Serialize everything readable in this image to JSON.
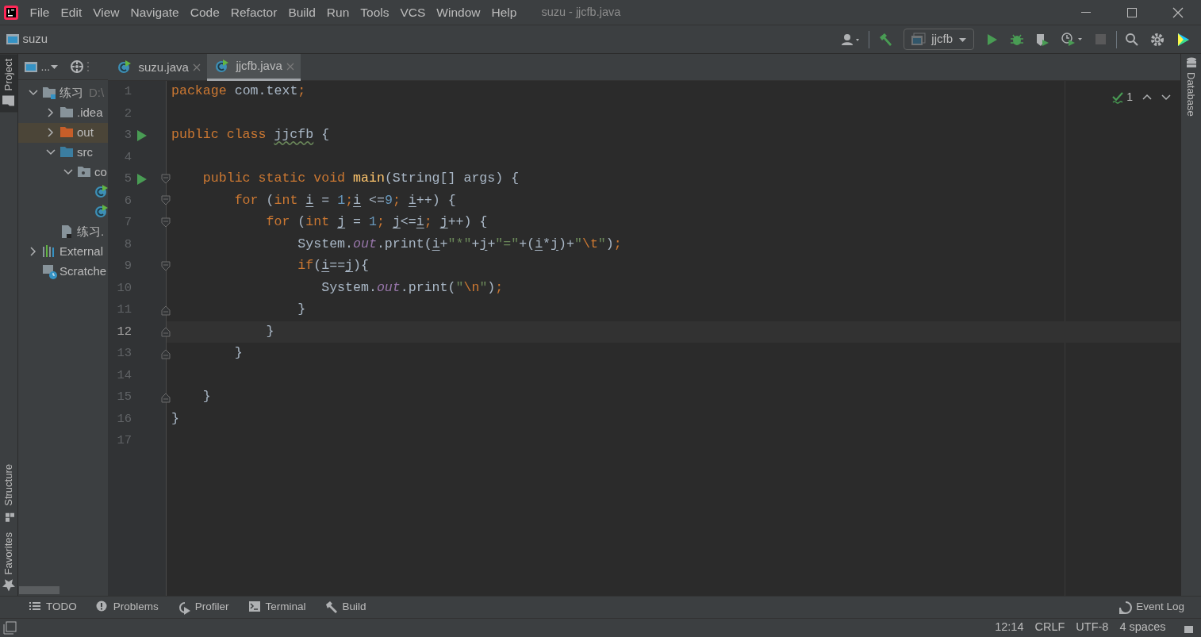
{
  "window": {
    "title": "suzu - jjcfb.java"
  },
  "menu": [
    "File",
    "Edit",
    "View",
    "Navigate",
    "Code",
    "Refactor",
    "Build",
    "Run",
    "Tools",
    "VCS",
    "Window",
    "Help"
  ],
  "navigation": {
    "project": "suzu",
    "run_configuration": "jjcfb"
  },
  "left_stripe": [
    {
      "label": "Project",
      "selected": true
    },
    {
      "label": "Structure",
      "selected": false
    },
    {
      "label": "Favorites",
      "selected": false
    }
  ],
  "right_stripe": [
    {
      "label": "Database",
      "selected": false
    }
  ],
  "project_panel": {
    "view_selector": "..."
  },
  "project_tree": [
    {
      "label": "练习",
      "path": "D:\\",
      "kind": "module",
      "expanded": true,
      "selected": false,
      "children": [
        {
          "label": ".idea",
          "kind": "folder",
          "expanded": false,
          "selected": false
        },
        {
          "label": "out",
          "kind": "excluded",
          "expanded": false,
          "selected": true
        },
        {
          "label": "src",
          "kind": "source",
          "expanded": true,
          "selected": false,
          "children": [
            {
              "label": "co",
              "kind": "package",
              "expanded": true,
              "selected": false,
              "children": [
                {
                  "kind": "class",
                  "selected": false
                },
                {
                  "kind": "class",
                  "selected": false
                }
              ]
            }
          ]
        },
        {
          "label": "练习.",
          "kind": "iml",
          "selected": false
        }
      ]
    },
    {
      "label": "External",
      "kind": "libraries",
      "expanded": false,
      "selected": false
    },
    {
      "label": "Scratche",
      "kind": "scratches",
      "selected": false
    }
  ],
  "editor_tabs": [
    {
      "label": "suzu.java",
      "selected": false
    },
    {
      "label": "jjcfb.java",
      "selected": true
    }
  ],
  "inspection": {
    "count": "1"
  },
  "code_lines": [
    {
      "number": "1",
      "tokens": [
        {
          "text": "package",
          "kind": "keyword"
        },
        {
          "text": " com.text",
          "kind": "plain"
        },
        {
          "text": ";",
          "kind": "keyword"
        }
      ]
    },
    {
      "number": "2"
    },
    {
      "number": "3",
      "run": true,
      "tokens": [
        {
          "text": "public class ",
          "kind": "keyword"
        },
        {
          "text": "jjcfb",
          "kind": "typo"
        },
        {
          "text": " {",
          "kind": "plain"
        }
      ]
    },
    {
      "number": "4"
    },
    {
      "number": "5",
      "run": true,
      "fold_start": true,
      "tokens": [
        {
          "text": "    public static void ",
          "kind": "keyword"
        },
        {
          "text": "main",
          "kind": "method"
        },
        {
          "text": "(String[] args) {",
          "kind": "plain"
        }
      ]
    },
    {
      "number": "6",
      "fold_start": true,
      "tokens": [
        {
          "text": "        for",
          "kind": "keyword"
        },
        {
          "text": " (",
          "kind": "plain"
        },
        {
          "text": "int ",
          "kind": "keyword"
        },
        {
          "text": "i",
          "kind": "var"
        },
        {
          "text": " = ",
          "kind": "plain"
        },
        {
          "text": "1",
          "kind": "number"
        },
        {
          "text": ";",
          "kind": "keyword"
        },
        {
          "text": "i",
          "kind": "var"
        },
        {
          "text": " <=",
          "kind": "plain"
        },
        {
          "text": "9",
          "kind": "number"
        },
        {
          "text": "; ",
          "kind": "keyword"
        },
        {
          "text": "i",
          "kind": "var"
        },
        {
          "text": "++) {",
          "kind": "plain"
        }
      ]
    },
    {
      "number": "7",
      "fold_start": true,
      "tokens": [
        {
          "text": "            for",
          "kind": "keyword"
        },
        {
          "text": " (",
          "kind": "plain"
        },
        {
          "text": "int ",
          "kind": "keyword"
        },
        {
          "text": "j",
          "kind": "var"
        },
        {
          "text": " = ",
          "kind": "plain"
        },
        {
          "text": "1",
          "kind": "number"
        },
        {
          "text": "; ",
          "kind": "keyword"
        },
        {
          "text": "j",
          "kind": "var"
        },
        {
          "text": "<=",
          "kind": "plain"
        },
        {
          "text": "i",
          "kind": "var"
        },
        {
          "text": "; ",
          "kind": "keyword"
        },
        {
          "text": "j",
          "kind": "var"
        },
        {
          "text": "++) {",
          "kind": "plain"
        }
      ]
    },
    {
      "number": "8",
      "tokens": [
        {
          "text": "                System.",
          "kind": "plain"
        },
        {
          "text": "out",
          "kind": "static"
        },
        {
          "text": ".print(",
          "kind": "plain"
        },
        {
          "text": "i",
          "kind": "var"
        },
        {
          "text": "+",
          "kind": "plain"
        },
        {
          "text": "\"*\"",
          "kind": "string"
        },
        {
          "text": "+",
          "kind": "plain"
        },
        {
          "text": "j",
          "kind": "var"
        },
        {
          "text": "+",
          "kind": "plain"
        },
        {
          "text": "\"=\"",
          "kind": "string"
        },
        {
          "text": "+(",
          "kind": "plain"
        },
        {
          "text": "i",
          "kind": "var"
        },
        {
          "text": "*",
          "kind": "plain"
        },
        {
          "text": "j",
          "kind": "var"
        },
        {
          "text": ")+",
          "kind": "plain"
        },
        {
          "text": "\"",
          "kind": "string"
        },
        {
          "text": "\\t",
          "kind": "escape"
        },
        {
          "text": "\"",
          "kind": "string"
        },
        {
          "text": ")",
          "kind": "plain"
        },
        {
          "text": ";",
          "kind": "keyword"
        }
      ]
    },
    {
      "number": "9",
      "fold_start": true,
      "tokens": [
        {
          "text": "                if",
          "kind": "keyword"
        },
        {
          "text": "(",
          "kind": "plain"
        },
        {
          "text": "i",
          "kind": "var"
        },
        {
          "text": "==",
          "kind": "plain"
        },
        {
          "text": "j",
          "kind": "var"
        },
        {
          "text": "){",
          "kind": "plain"
        }
      ]
    },
    {
      "number": "10",
      "tokens": [
        {
          "text": "                   System.",
          "kind": "plain"
        },
        {
          "text": "out",
          "kind": "static"
        },
        {
          "text": ".print(",
          "kind": "plain"
        },
        {
          "text": "\"",
          "kind": "string"
        },
        {
          "text": "\\n",
          "kind": "escape"
        },
        {
          "text": "\"",
          "kind": "string"
        },
        {
          "text": ")",
          "kind": "plain"
        },
        {
          "text": ";",
          "kind": "keyword"
        }
      ]
    },
    {
      "number": "11",
      "fold_end": true,
      "tokens": [
        {
          "text": "                }",
          "kind": "plain"
        }
      ]
    },
    {
      "number": "12",
      "fold_end": true,
      "current": true,
      "tokens": [
        {
          "text": "            }",
          "kind": "plain"
        }
      ]
    },
    {
      "number": "13",
      "fold_end": true,
      "tokens": [
        {
          "text": "        }",
          "kind": "plain"
        }
      ]
    },
    {
      "number": "14"
    },
    {
      "number": "15",
      "fold_end": true,
      "tokens": [
        {
          "text": "    }",
          "kind": "plain"
        }
      ]
    },
    {
      "number": "16",
      "tokens": [
        {
          "text": "}",
          "kind": "plain"
        }
      ]
    },
    {
      "number": "17"
    }
  ],
  "tool_windows": [
    {
      "label": "TODO",
      "kind": "todo"
    },
    {
      "label": "Problems",
      "kind": "problems"
    },
    {
      "label": "Profiler",
      "kind": "profiler"
    },
    {
      "label": "Terminal",
      "kind": "terminal"
    },
    {
      "label": "Build",
      "kind": "build"
    }
  ],
  "event_log": {
    "label": "Event Log"
  },
  "status_bar": [
    "12:14",
    "CRLF",
    "UTF-8",
    "4 spaces"
  ]
}
